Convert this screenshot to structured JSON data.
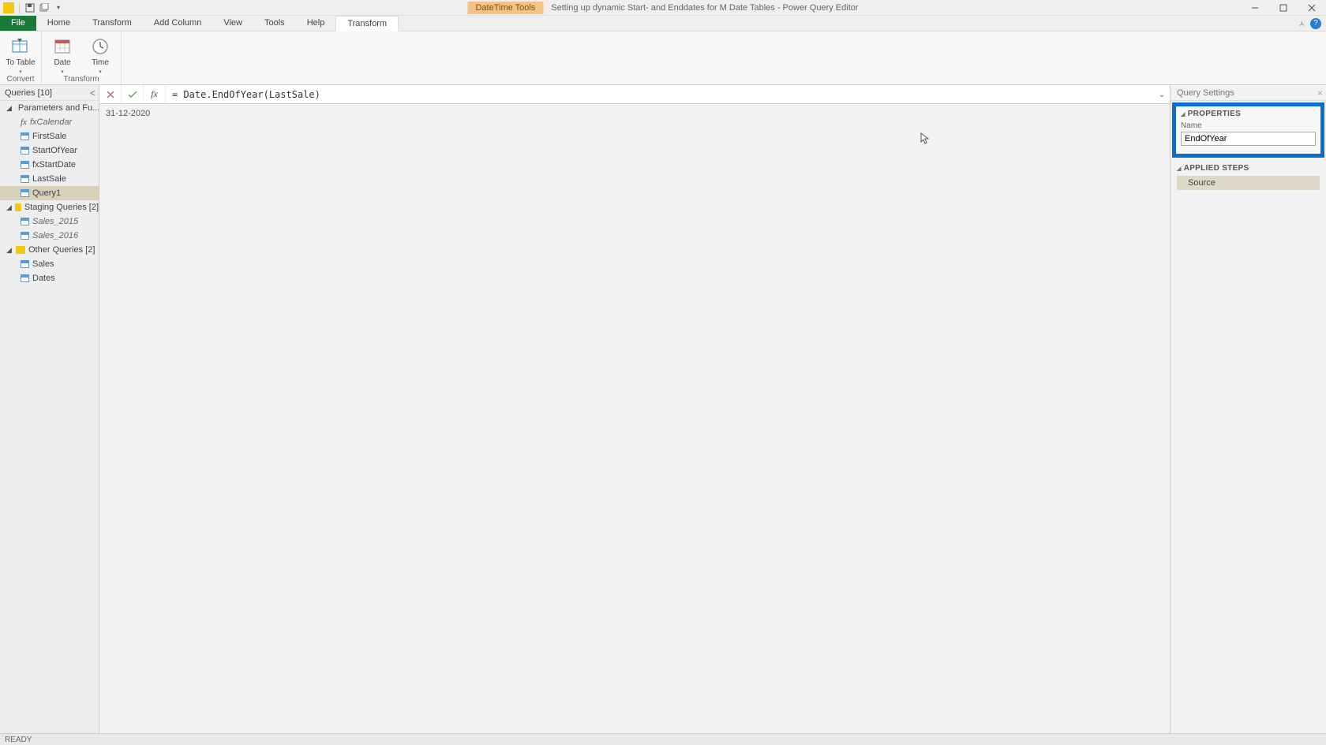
{
  "titlebar": {
    "context_tab": "DateTime Tools",
    "title": "Setting up dynamic Start- and Enddates for M Date Tables - Power Query Editor"
  },
  "menu": {
    "file": "File",
    "tabs": [
      "Home",
      "Transform",
      "Add Column",
      "View",
      "Tools",
      "Help"
    ],
    "context_transform": "Transform"
  },
  "ribbon": {
    "group1": {
      "label": "Convert",
      "btn_totable": "To Table"
    },
    "group2": {
      "label": "Transform",
      "btn_date": "Date",
      "btn_time": "Time"
    }
  },
  "queries": {
    "header": "Queries [10]",
    "groups": [
      {
        "name": "Parameters and Fu...",
        "items": [
          {
            "label": "fxCalendar",
            "type": "fx",
            "italic": true
          },
          {
            "label": "FirstSale",
            "type": "table"
          },
          {
            "label": "StartOfYear",
            "type": "table"
          },
          {
            "label": "fxStartDate",
            "type": "table"
          },
          {
            "label": "LastSale",
            "type": "table"
          },
          {
            "label": "Query1",
            "type": "table",
            "selected": true
          }
        ]
      },
      {
        "name": "Staging Queries [2]",
        "items": [
          {
            "label": "Sales_2015",
            "type": "table",
            "italic": true
          },
          {
            "label": "Sales_2016",
            "type": "table",
            "italic": true
          }
        ]
      },
      {
        "name": "Other Queries [2]",
        "items": [
          {
            "label": "Sales",
            "type": "table"
          },
          {
            "label": "Dates",
            "type": "table"
          }
        ]
      }
    ]
  },
  "formula": {
    "text": "= Date.EndOfYear(LastSale)"
  },
  "data": {
    "value": "31-12-2020"
  },
  "settings": {
    "header": "Query Settings",
    "properties_title": "PROPERTIES",
    "name_label": "Name",
    "name_value": "EndOfYear",
    "applied_title": "APPLIED STEPS",
    "steps": [
      "Source"
    ]
  },
  "status": "READY"
}
